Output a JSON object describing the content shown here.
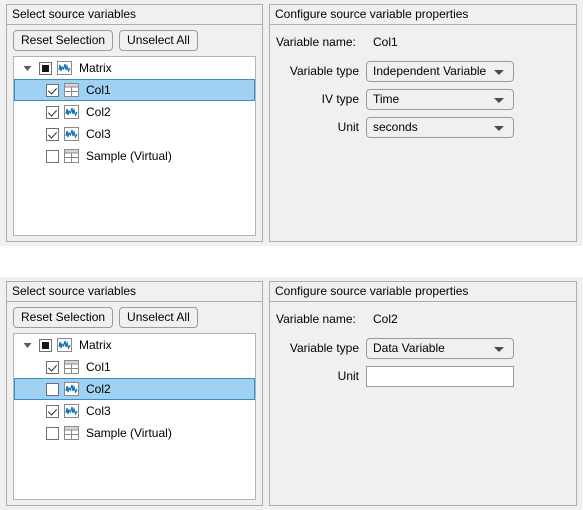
{
  "sections": [
    {
      "left_panel": {
        "title": "Select source variables",
        "buttons": {
          "reset": "Reset Selection",
          "unselect": "Unselect All"
        },
        "tree": [
          {
            "label": "Matrix",
            "level": 0,
            "check": "partial",
            "icon": "signal-icon",
            "selected": false,
            "expanded": true
          },
          {
            "label": "Col1",
            "level": 1,
            "check": "checked",
            "icon": "table-icon",
            "selected": true,
            "expanded": false
          },
          {
            "label": "Col2",
            "level": 1,
            "check": "checked",
            "icon": "signal-icon",
            "selected": false,
            "expanded": false
          },
          {
            "label": "Col3",
            "level": 1,
            "check": "checked",
            "icon": "signal-icon",
            "selected": false,
            "expanded": false
          },
          {
            "label": "Sample (Virtual)",
            "level": 1,
            "check": "unchecked",
            "icon": "table-icon",
            "selected": false,
            "expanded": false
          }
        ]
      },
      "right_panel": {
        "title": "Configure source variable properties",
        "variable_name_label": "Variable name:",
        "variable_name_value": "Col1",
        "fields": [
          {
            "label": "Variable type",
            "control": "combo",
            "value": "Independent Variable"
          },
          {
            "label": "IV type",
            "control": "combo",
            "value": "Time"
          },
          {
            "label": "Unit",
            "control": "combo",
            "value": "seconds"
          }
        ]
      }
    },
    {
      "left_panel": {
        "title": "Select source variables",
        "buttons": {
          "reset": "Reset Selection",
          "unselect": "Unselect All"
        },
        "tree": [
          {
            "label": "Matrix",
            "level": 0,
            "check": "partial",
            "icon": "signal-icon",
            "selected": false,
            "expanded": true
          },
          {
            "label": "Col1",
            "level": 1,
            "check": "checked",
            "icon": "table-icon",
            "selected": false,
            "expanded": false
          },
          {
            "label": "Col2",
            "level": 1,
            "check": "unchecked",
            "icon": "signal-icon",
            "selected": true,
            "expanded": false
          },
          {
            "label": "Col3",
            "level": 1,
            "check": "checked",
            "icon": "signal-icon",
            "selected": false,
            "expanded": false
          },
          {
            "label": "Sample (Virtual)",
            "level": 1,
            "check": "unchecked",
            "icon": "table-icon",
            "selected": false,
            "expanded": false
          }
        ]
      },
      "right_panel": {
        "title": "Configure source variable properties",
        "variable_name_label": "Variable name:",
        "variable_name_value": "Col2",
        "fields": [
          {
            "label": "Variable type",
            "control": "combo",
            "value": "Data Variable"
          },
          {
            "label": "Unit",
            "control": "text",
            "value": "",
            "placeholder": ""
          }
        ]
      }
    }
  ],
  "colors": {
    "selection_fill": "#9fd2f2",
    "selection_border": "#3c8dc4",
    "panel_bg": "#f0f0f0",
    "panel_border": "#adadad",
    "tree_bg": "#ffffff",
    "signal_icon": "#0b72b5"
  }
}
